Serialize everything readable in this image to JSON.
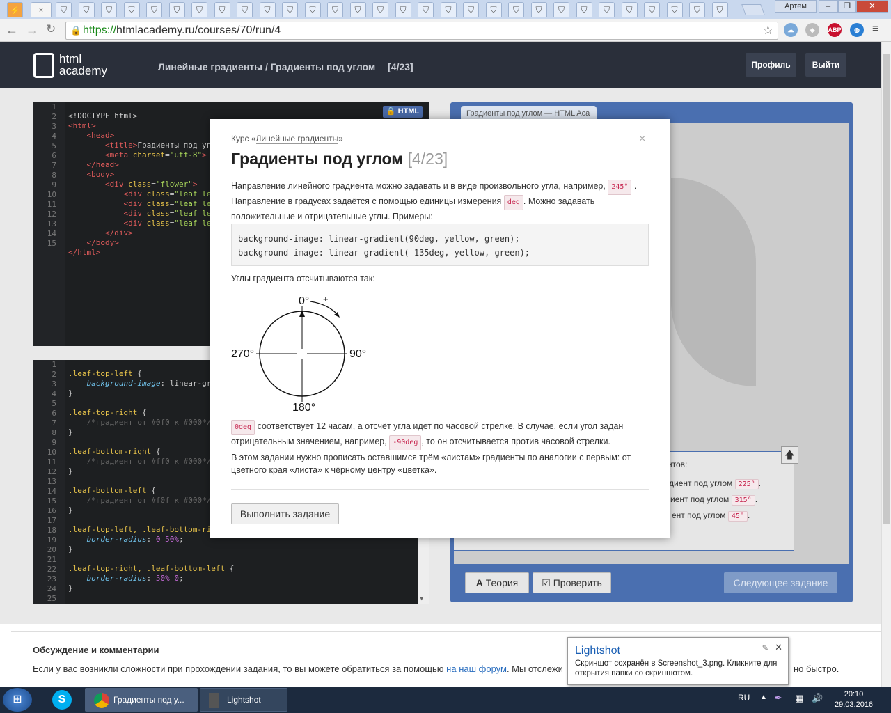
{
  "browser": {
    "user": "Артем",
    "url_scheme": "https://",
    "url_rest": "htmlacademy.ru/courses/70/run/4",
    "tab_close": "×",
    "tab_icon": "shield-icon"
  },
  "header": {
    "logo_line1": "html",
    "logo_line2": "academy",
    "crumb_course": "Линейные градиенты",
    "crumb_sep": " / ",
    "crumb_task": "Градиенты под углом",
    "crumb_counter": "[4/23]",
    "profile_btn": "Профиль",
    "logout_btn": "Выйти"
  },
  "html_editor": {
    "badge": "HTML",
    "lines": [
      "1",
      "2",
      "3",
      "4",
      "5",
      "6",
      "7",
      "8",
      "9",
      "10",
      "11",
      "12",
      "13",
      "14",
      "15"
    ]
  },
  "css_editor": {
    "lines": [
      "1",
      "2",
      "3",
      "4",
      "5",
      "6",
      "7",
      "8",
      "9",
      "10",
      "11",
      "12",
      "13",
      "14",
      "15",
      "16",
      "17",
      "18",
      "19",
      "20",
      "21",
      "22",
      "23",
      "24",
      "25"
    ]
  },
  "preview": {
    "tab_title": "Градиенты под углом — HTML Aca",
    "task_intro": "нтов:",
    "task_items": [
      {
        "text": "диент под углом",
        "value": "225°"
      },
      {
        "text": "иент под углом",
        "value": "315°"
      },
      {
        "text": "ент под углом",
        "value": "45°"
      }
    ],
    "theory_btn": "Теория",
    "check_btn": "Проверить",
    "next_btn": "Следующее задание"
  },
  "modal": {
    "course_prefix": "Курс «",
    "course_name": "Линейные градиенты",
    "course_suffix": "»",
    "close": "×",
    "title": "Градиенты под углом",
    "counter": "[4/23]",
    "p1_a": "Направление линейного градиента можно задавать и в виде произвольного угла, например,",
    "p1_code1": "245°",
    "p1_b": ". Направление в градусах задаётся с помощью единицы измерения",
    "p1_code2": "deg",
    "p1_c": ". Можно задавать положительные и отрицательные углы. Примеры:",
    "code_line1": "background-image: linear-gradient(90deg, yellow, green);",
    "code_line2": "background-image: linear-gradient(-135deg, yellow, green);",
    "p2": "Углы градиента отсчитываются так:",
    "diagram": {
      "top": "0°",
      "plus": "+",
      "right": "90°",
      "bottom": "180°",
      "left": "270°"
    },
    "p3_code1": "0deg",
    "p3_a": "соответствует 12 часам, а отсчёт угла идет по часовой стрелке. В случае, если угол задан отрицательным значением, например,",
    "p3_code2": "-90deg",
    "p3_b": ", то он отсчитывается против часовой стрелки.",
    "p4": "В этом задании нужно прописать оставшимся трём «листам» градиенты по аналогии с первым: от цветного края «листа» к чёрному центру «цветка».",
    "button": "Выполнить задание"
  },
  "discussion": {
    "title": "Обсуждение и комментарии",
    "text_a": "Если у вас возникли сложности при прохождении задания, то вы можете обратиться за помощью",
    "link": "на наш форум",
    "text_b": ". Мы отслежи",
    "text_c": "но быстро."
  },
  "lightshot": {
    "title": "Lightshot",
    "text1": "Скриншот сохранён в Screenshot_3.png. Кликните для",
    "text2": "открытия папки со скриншотом."
  },
  "taskbar": {
    "chrome_item": "Градиенты под у...",
    "lightshot_item": "Lightshot",
    "lang": "RU",
    "time": "20:10",
    "date": "29.03.2016"
  }
}
